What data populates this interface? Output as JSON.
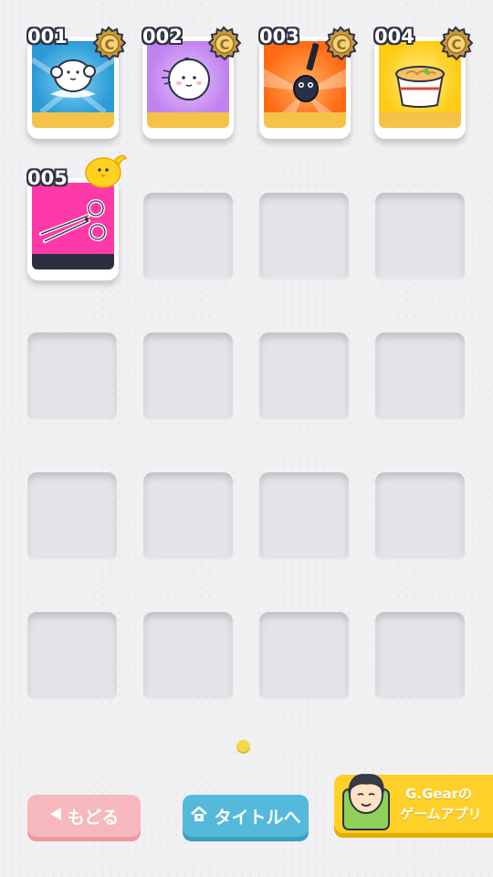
{
  "cards": [
    {
      "number": "001",
      "art": "cloud-ghost",
      "bg": "#2c9ad6",
      "bar": "#f5c248",
      "medal": true
    },
    {
      "number": "002",
      "art": "baby-face",
      "bg": "#c182ef",
      "bar": "#f5c248",
      "medal": true
    },
    {
      "number": "003",
      "art": "black-bug",
      "bg": "#ff6a14",
      "bar": "#f5c248",
      "medal": true
    },
    {
      "number": "004",
      "art": "ramen-cup",
      "bg": "#ffcb14",
      "bar": "#f5c248",
      "medal": true
    },
    {
      "number": "005",
      "art": "scissors",
      "bg": "#ff3aa8",
      "bar": "#2b2f40",
      "medal": false,
      "new_badge": "chick"
    }
  ],
  "empty_slot_count": 15,
  "medal_letter": "C",
  "pager": {
    "pages": 1,
    "current": 1
  },
  "buttons": {
    "back_label": "もどる",
    "title_label": "タイトルへ"
  },
  "promo": {
    "line1": "G.Gearの",
    "line2": "ゲームアプリ"
  },
  "colors": {
    "back": "#f6b8bc",
    "title": "#55b9dc",
    "promo": "#ffd028"
  }
}
